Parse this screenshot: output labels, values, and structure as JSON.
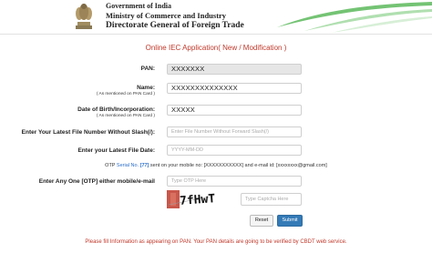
{
  "header": {
    "gov_line1": "Government of India",
    "gov_line2": "Ministry of Commerce and Industry",
    "gov_line3": "Directorate General of Foreign Trade",
    "emblem_icon": "national-emblem-icon",
    "swoosh_color": "#5cb85c"
  },
  "form": {
    "title": "Online IEC Application( New / Modification )",
    "pan": {
      "label": "PAN:",
      "value": "XXXXXXX"
    },
    "name": {
      "label": "Name:",
      "sublabel": "( As mentioned on PAN Card )",
      "value": "XXXXXXXXXXXXXX"
    },
    "dob": {
      "label": "Date of Birth/Incorporation:",
      "sublabel": "( As mentioned on PAN Card )",
      "value": "XXXXX"
    },
    "file_number": {
      "label": "Enter Your Latest File Number Without Slash(/):",
      "placeholder": "Enter File Number Without Forward Slash(/)"
    },
    "file_date": {
      "label": "Enter your Latest File Date:",
      "placeholder": "YYYY-MM-DD"
    },
    "otp_info": {
      "prefix": "OTP ",
      "serial_label": "Serial No.",
      "serial_number": "[77]",
      "rest": " sent on your mobile no: [XXXXXXXXXXX] and e-mail id: [xxxxxxxx@gmail.com]"
    },
    "otp": {
      "label": "Enter Any One [OTP] either mobile/e-mail",
      "placeholder": "Type OTP  Here"
    },
    "captcha": {
      "text": "7fHwTj",
      "placeholder": "Type Captcha Here"
    },
    "reset_label": "Reset",
    "submit_label": "Submit",
    "note": "Please fill Information as appearing on PAN. Your PAN details are going to be verified by CBDT web service."
  }
}
